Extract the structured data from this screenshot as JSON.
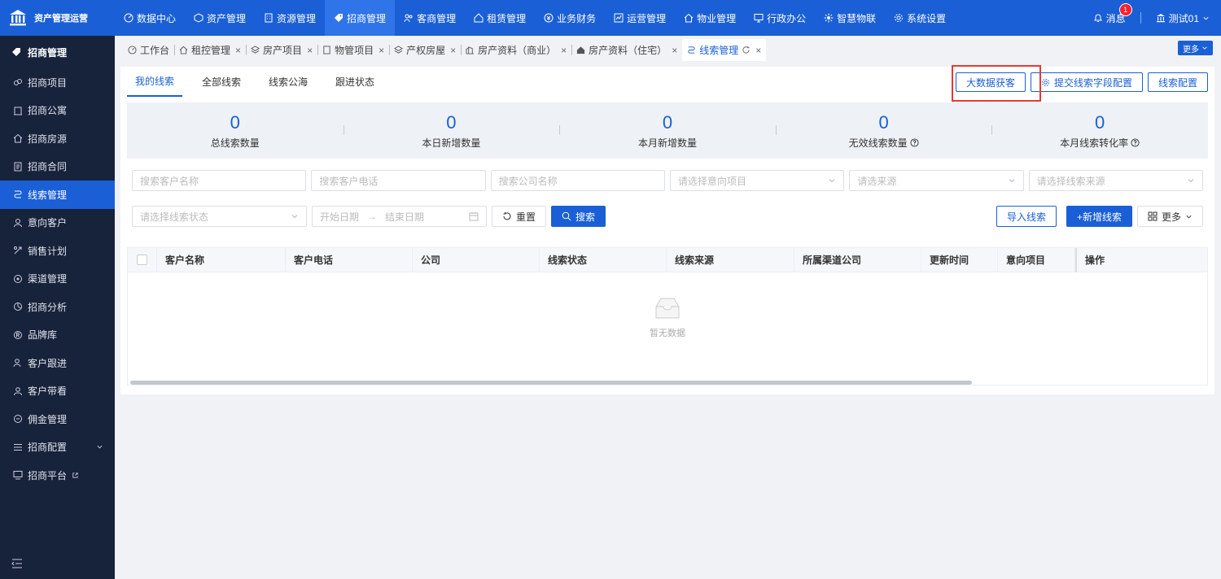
{
  "brand": {
    "name": "资产管理运营"
  },
  "topnav": [
    {
      "label": "数据中心",
      "icon": "dashboard-icon"
    },
    {
      "label": "资产管理",
      "icon": "cube-icon"
    },
    {
      "label": "资源管理",
      "icon": "building-icon"
    },
    {
      "label": "招商管理",
      "icon": "tag-icon",
      "active": true
    },
    {
      "label": "客商管理",
      "icon": "users-icon"
    },
    {
      "label": "租赁管理",
      "icon": "house-icon"
    },
    {
      "label": "业务财务",
      "icon": "coin-icon"
    },
    {
      "label": "运营管理",
      "icon": "chart-icon"
    },
    {
      "label": "物业管理",
      "icon": "home-icon"
    },
    {
      "label": "行政办公",
      "icon": "monitor-icon"
    },
    {
      "label": "智慧物联",
      "icon": "iot-icon"
    },
    {
      "label": "系统设置",
      "icon": "gear-icon"
    }
  ],
  "topright": {
    "messages_label": "消息",
    "badge": "1",
    "user": "测试01"
  },
  "sidebar": {
    "title": "招商管理",
    "items": [
      {
        "label": "招商项目"
      },
      {
        "label": "招商公寓"
      },
      {
        "label": "招商房源"
      },
      {
        "label": "招商合同"
      },
      {
        "label": "线索管理",
        "active": true
      },
      {
        "label": "意向客户"
      },
      {
        "label": "销售计划"
      },
      {
        "label": "渠道管理"
      },
      {
        "label": "招商分析"
      },
      {
        "label": "品牌库"
      },
      {
        "label": "客户跟进"
      },
      {
        "label": "客户带看"
      },
      {
        "label": "佣金管理"
      },
      {
        "label": "招商配置"
      },
      {
        "label": "招商平台"
      }
    ]
  },
  "tabs": [
    {
      "label": "工作台"
    },
    {
      "label": "租控管理"
    },
    {
      "label": "房产项目"
    },
    {
      "label": "物管项目"
    },
    {
      "label": "产权房屋"
    },
    {
      "label": "房产资料（商业）"
    },
    {
      "label": "房产资料（住宅）"
    },
    {
      "label": "线索管理",
      "active": true
    }
  ],
  "tabs_more": "更多",
  "subtabs": [
    "我的线索",
    "全部线索",
    "线索公海",
    "跟进状态"
  ],
  "actions": {
    "big_data": "大数据获客",
    "field_config": "提交线索字段配置",
    "clue_config": "线索配置"
  },
  "stats": [
    {
      "value": "0",
      "label": "总线索数量"
    },
    {
      "value": "0",
      "label": "本日新增数量"
    },
    {
      "value": "0",
      "label": "本月新增数量"
    },
    {
      "value": "0",
      "label": "无效线索数量"
    },
    {
      "value": "0",
      "label": "本月线索转化率"
    }
  ],
  "filters": {
    "customer_name": "搜索客户名称",
    "customer_phone": "搜索客户电话",
    "company": "搜索公司名称",
    "project": "请选择意向项目",
    "source": "请选来源",
    "clue_source": "请选择线索来源",
    "clue_status": "请选择线索状态",
    "start_date": "开始日期",
    "end_date": "结束日期",
    "reset": "重置",
    "search": "搜索",
    "import": "导入线索",
    "add": "+新增线索",
    "more": "更多"
  },
  "table": {
    "columns": [
      "客户名称",
      "客户电话",
      "公司",
      "线索状态",
      "线索来源",
      "所属渠道公司",
      "更新时间",
      "意向项目",
      "操作"
    ],
    "empty": "暂无数据"
  }
}
